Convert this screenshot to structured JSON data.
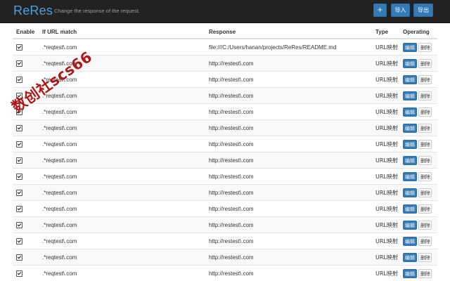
{
  "header": {
    "brand": "ReRes",
    "tagline": "Change the response of the request.",
    "add_label": "+",
    "import_label": "导入",
    "export_label": "导出"
  },
  "table": {
    "columns": [
      "Enable",
      "If URL match",
      "Response",
      "Type",
      "Operating"
    ],
    "rows": [
      {
        "match": ".*reqtest\\.com",
        "response": "file:///C:/Users/hanan/projects/ReRes/README.md",
        "type": "URL映射"
      },
      {
        "match": ".*reqtest\\.com",
        "response": "http://restest\\.com",
        "type": "URL映射"
      },
      {
        "match": ".*reqtest\\.com",
        "response": "http://restest\\.com",
        "type": "URL映射"
      },
      {
        "match": ".*reqtest\\.com",
        "response": "http://restest\\.com",
        "type": "URL映射"
      },
      {
        "match": ".*reqtest\\.com",
        "response": "http://restest\\.com",
        "type": "URL映射"
      },
      {
        "match": ".*reqtest\\.com",
        "response": "http://restest\\.com",
        "type": "URL映射"
      },
      {
        "match": ".*reqtest\\.com",
        "response": "http://restest\\.com",
        "type": "URL映射"
      },
      {
        "match": ".*reqtest\\.com",
        "response": "http://restest\\.com",
        "type": "URL映射"
      },
      {
        "match": ".*reqtest\\.com",
        "response": "http://restest\\.com",
        "type": "URL映射"
      },
      {
        "match": ".*reqtest\\.com",
        "response": "http://restest\\.com",
        "type": "URL映射"
      },
      {
        "match": ".*reqtest\\.com",
        "response": "http://restest\\.com",
        "type": "URL映射"
      },
      {
        "match": ".*reqtest\\.com",
        "response": "http://restest\\.com",
        "type": "URL映射"
      },
      {
        "match": ".*reqtest\\.com",
        "response": "http://restest\\.com",
        "type": "URL映射"
      },
      {
        "match": ".*reqtest\\.com",
        "response": "http://restest\\.com",
        "type": "URL映射"
      },
      {
        "match": ".*reqtest\\.com",
        "response": "http://restest\\.com",
        "type": "URL映射"
      }
    ],
    "edit_label": "编辑",
    "delete_label": "删除"
  },
  "watermark": "数创社scs66",
  "colors": {
    "navbar": "#222222",
    "brand": "#4a9fe0",
    "primary_button": "#337ab7",
    "watermark": "#b01818"
  }
}
